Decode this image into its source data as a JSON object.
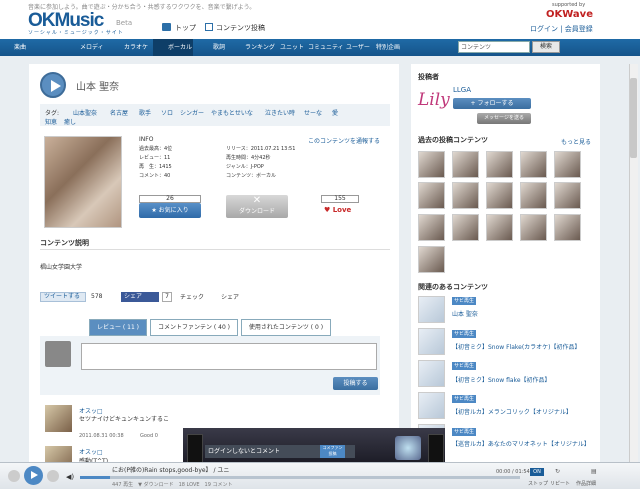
{
  "header": {
    "tagline": "音楽に参加しよう。曲で遊ぶ・分かち合う・共感するワクワクを、音楽で繋げよう。",
    "logo": "OKMusic",
    "logo_beta": "Beta",
    "logo_sub": "ソーシャル・ミュージック・サイト",
    "nav_top": "トップ",
    "nav_post": "コンテンツ投稿",
    "okwave_supported": "supported by",
    "okwave": "OKWave",
    "login": "ログイン | 会員登録"
  },
  "navbar": {
    "items": [
      "楽曲",
      "メロディ",
      "カラオケ",
      "ボーカル",
      "歌詞",
      "ランキング",
      "ユニット",
      "コミュニティ",
      "ユーザー",
      "特別企画"
    ],
    "search_placeholder": "コンテンツ",
    "search_button": "検索"
  },
  "content": {
    "title": "山本 聖奈",
    "tag_label": "タグ:",
    "tags": [
      "山本聖奈",
      "名古屋",
      "歌手",
      "ソロ",
      "シンガー",
      "やまもとせいな",
      "泣きたい時",
      "せーな",
      "愛",
      "知恵",
      "癒し"
    ],
    "info_header": "INFO",
    "report_link": "このコンテンツを通報する",
    "info_left": [
      "過去最高：4位",
      "レビュー：11",
      "再　生：1415",
      "コメント：40"
    ],
    "info_right": [
      "リリース：2011.07.21 13:51",
      "再生時間：4分42秒",
      "ジャンル：J-POP",
      "コンテンツ：ボーカル"
    ],
    "favorite_count": "26",
    "favorite_label": "★ お気に入り",
    "download_label": "ダウンロード",
    "love_count": "155",
    "love_label": "Love",
    "description_header": "コンテンツ説明",
    "description": "椙山女学園大学",
    "share": {
      "tweet_label": "ツイートする",
      "tweet_count": "578",
      "fb_label": "シェア",
      "fb_count": "7",
      "check_label": "チェック",
      "share_label": "シェア"
    },
    "tabs": [
      "レビュー ( 11 )",
      "コメントファンテン ( 40 )",
      "使用されたコンテンツ ( 0 )"
    ],
    "post_button": "投稿する",
    "reviews": [
      {
        "name": "オスッ□",
        "text": "セツナイけどキュンキュンするこ",
        "date": "2011.08.31 00:38",
        "good": "Good 0"
      },
      {
        "name": "オスッ□",
        "text": "感動(T^T)"
      }
    ]
  },
  "sidebar": {
    "poster_header": "投稿者",
    "poster_logo": "Lily",
    "poster_name": "LLGA",
    "follow_button": "+ フォローする",
    "message_button": "メッセージを送る",
    "past_header": "過去の投稿コンテンツ",
    "more_link": "もっと見る",
    "related_header": "関連のあるコンテンツ",
    "related": [
      {
        "badge": "サビ再生",
        "title": "山本 聖奈"
      },
      {
        "badge": "サビ再生",
        "title": "【初音ミク】Snow Flake(カラオケ)【初作品】"
      },
      {
        "badge": "サビ再生",
        "title": "【初音ミク】Snow flake【初作品】"
      },
      {
        "badge": "サビ再生",
        "title": "【初音ルカ】メランコリック【オリジナル】"
      },
      {
        "badge": "サビ再生",
        "title": "【巡音ルカ】あなたのマリオネット【オリジナル】"
      }
    ]
  },
  "player": {
    "song": "にお(P雑の)Rain stops,good-bye】 / ユニ",
    "stats": "447 再生　▼ ダウンロード　18 LOVE　19 コメント",
    "time": "00:00 / 01:54",
    "on_label": "ON",
    "repeat": "↻",
    "info": "▤",
    "label_stop": "ストップ",
    "label_repeat": "リピート",
    "label_info": "作品詳細"
  },
  "stage": {
    "popup": "ログインしないとコメント",
    "button": "コメファン 投稿"
  },
  "colors": {
    "brand": "#1a5c98",
    "nav": "#1f6aa6",
    "okwave": "#c02020",
    "love": "#c82828"
  }
}
